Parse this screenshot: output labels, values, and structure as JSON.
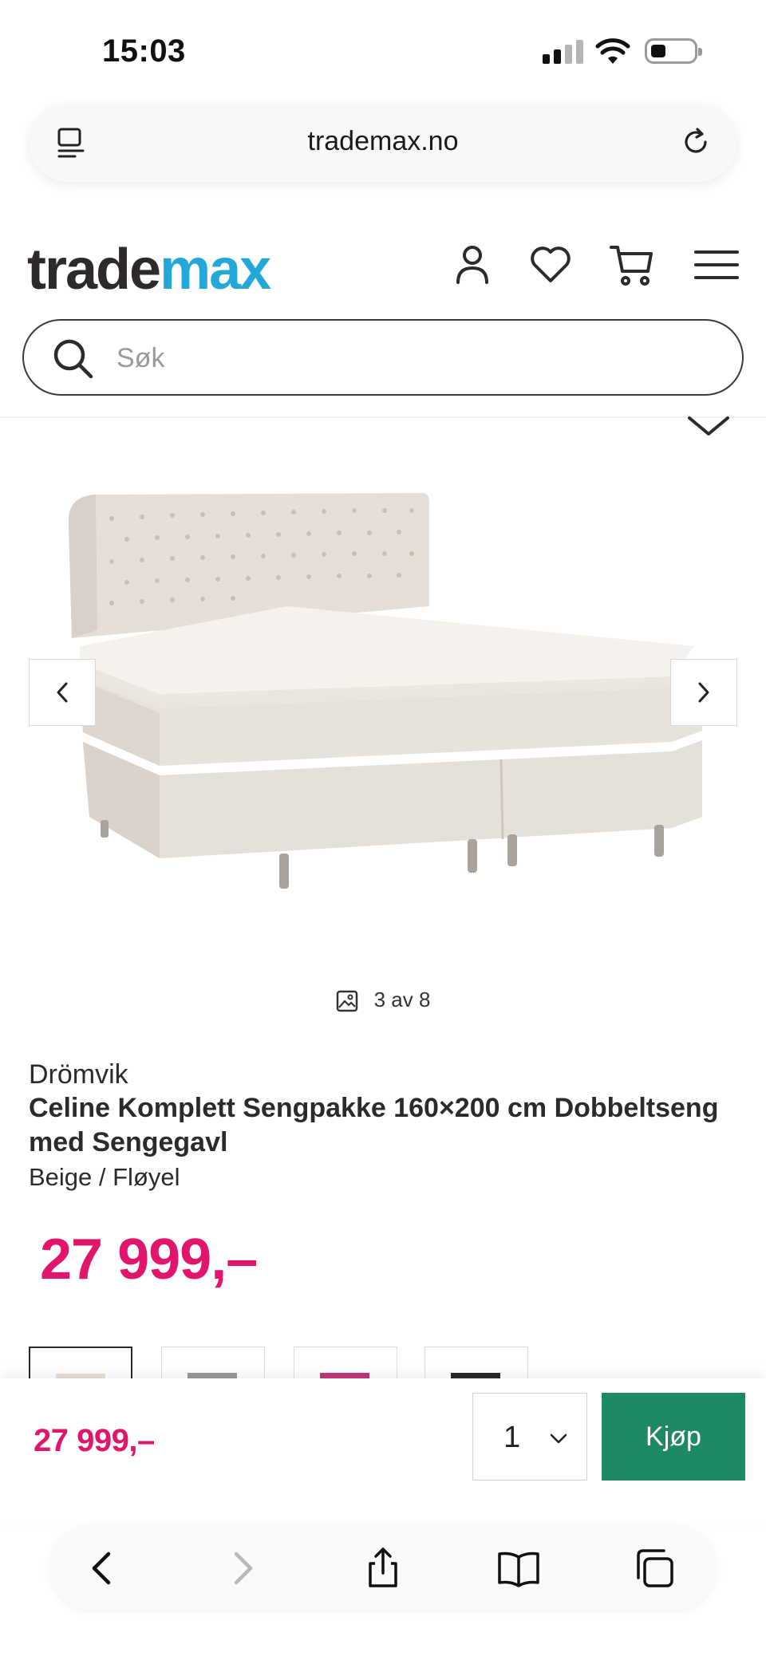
{
  "status_bar": {
    "time": "15:03"
  },
  "browser": {
    "url": "trademax.no"
  },
  "header": {
    "logo_part1": "trade",
    "logo_part2": "max",
    "search_placeholder": "Søk"
  },
  "gallery": {
    "counter": "3 av 8"
  },
  "product": {
    "brand": "Drömvik",
    "title": "Celine Komplett Sengpakke 160×200 cm Dobbeltseng med Sengegavl",
    "variant": "Beige / Fløyel",
    "price": "27 999,–"
  },
  "swatches": [
    {
      "name": "beige",
      "color": "#e8e0d8"
    },
    {
      "name": "grey",
      "color": "#9a9a9a"
    },
    {
      "name": "pink",
      "color": "#c0397a"
    },
    {
      "name": "black",
      "color": "#2a2a2a"
    }
  ],
  "buy_bar": {
    "price": "27 999,–",
    "quantity": "1",
    "buy_label": "Kjøp"
  },
  "colors": {
    "brand_blue": "#23a8d8",
    "price_pink": "#e0156b",
    "buy_green": "#1e8a63"
  },
  "icons": {
    "header": [
      "user-icon",
      "heart-icon",
      "cart-icon",
      "menu-icon"
    ],
    "toolbar": [
      "back-icon",
      "forward-icon",
      "share-icon",
      "bookmarks-icon",
      "tabs-icon"
    ]
  }
}
